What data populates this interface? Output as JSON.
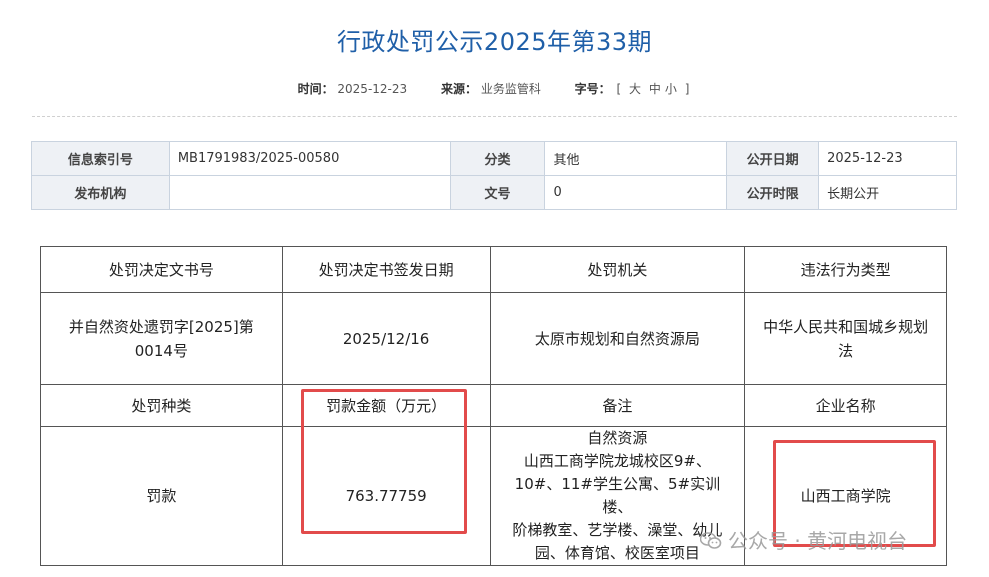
{
  "page": {
    "title": "行政处罚公示2025年第33期"
  },
  "meta": {
    "time_label": "时间：",
    "time_value": "2025-12-23",
    "source_label": "来源：",
    "source_value": "业务监管科",
    "fontsize_label": "字号：",
    "fontsize_open": "[",
    "fontsize_large": "大",
    "fontsize_medium": "中",
    "fontsize_small": "小",
    "fontsize_close": "]"
  },
  "info": {
    "index_label": "信息索引号",
    "index_value": "MB1791983/2025-00580",
    "category_label": "分类",
    "category_value": "其他",
    "pubdate_label": "公开日期",
    "pubdate_value": "2025-12-23",
    "org_label": "发布机构",
    "org_value": "",
    "docno_label": "文号",
    "docno_value": "0",
    "period_label": "公开时限",
    "period_value": "长期公开"
  },
  "penalty": {
    "h_doc_no": "处罚决定文书号",
    "h_issue_date": "处罚决定书签发日期",
    "h_authority": "处罚机关",
    "h_violation_type": "违法行为类型",
    "doc_no_line1": "并自然资处遗罚字[2025]第",
    "doc_no_line2": "0014号",
    "issue_date": "2025/12/16",
    "authority": "太原市规划和自然资源局",
    "violation_line1": "中华人民共和国城乡规划",
    "violation_line2": "法",
    "h_penalty_kind": "处罚种类",
    "h_fine_amount": "罚款金额（万元）",
    "h_note": "备注",
    "h_company": "企业名称",
    "penalty_kind": "罚款",
    "fine_amount": "763.77759",
    "note_line1": "自然资源",
    "note_line2": "山西工商学院龙城校区9#、",
    "note_line3": "10#、11#学生公寓、5#实训楼、",
    "note_line4": "阶梯教室、艺学楼、澡堂、幼儿",
    "note_line5": "园、体育馆、校医室项目",
    "company": "山西工商学院"
  },
  "watermark": {
    "text": "公众号 · 黄河电视台"
  },
  "colors": {
    "title": "#1f5fa8",
    "highlight_box": "#e24b4b",
    "label_bg": "#eef1f5"
  }
}
